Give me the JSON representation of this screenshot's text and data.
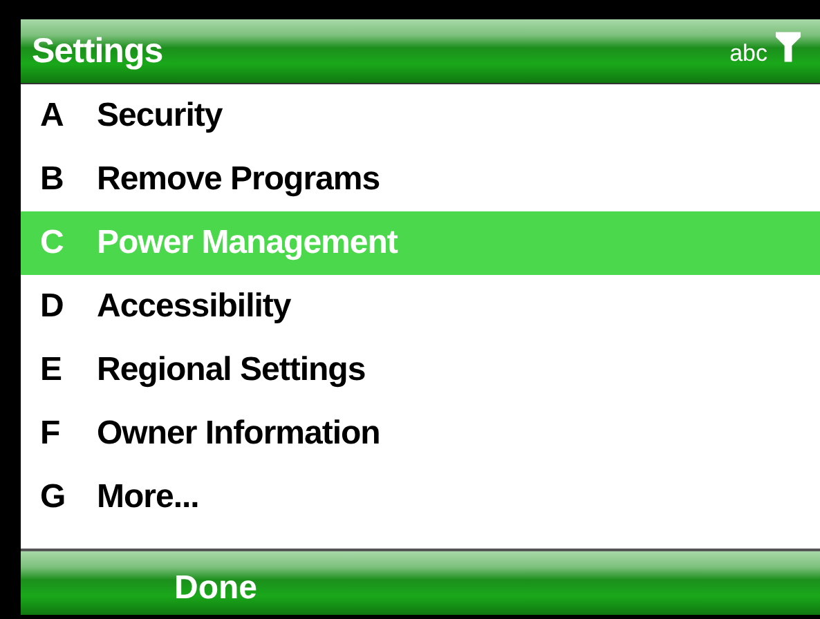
{
  "title_bar": {
    "title": "Settings",
    "input_mode": "abc"
  },
  "menu": [
    {
      "key": "A",
      "label": "Security",
      "selected": false
    },
    {
      "key": "B",
      "label": "Remove Programs",
      "selected": false
    },
    {
      "key": "C",
      "label": "Power Management",
      "selected": true
    },
    {
      "key": "D",
      "label": "Accessibility",
      "selected": false
    },
    {
      "key": "E",
      "label": "Regional Settings",
      "selected": false
    },
    {
      "key": "F",
      "label": "Owner Information",
      "selected": false
    },
    {
      "key": "G",
      "label": "More...",
      "selected": false
    }
  ],
  "soft_keys": {
    "left": "Done"
  }
}
